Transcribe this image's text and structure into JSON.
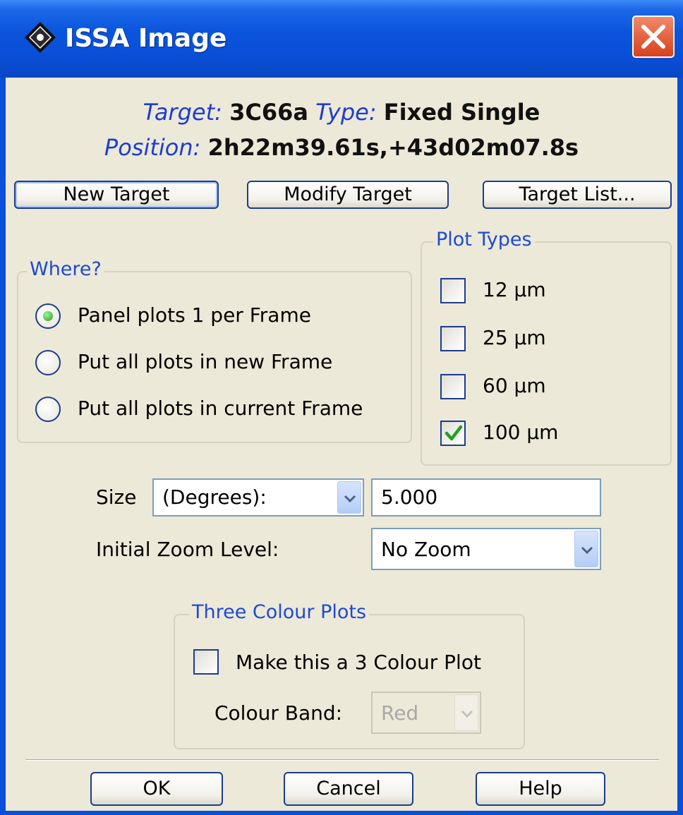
{
  "window": {
    "title": "ISSA Image",
    "icon": "app-diamond-icon",
    "close_icon": "close-x-icon"
  },
  "header": {
    "target_label": "Target:",
    "target_value": "3C66a",
    "type_label": "Type:",
    "type_value": "Fixed Single",
    "position_label": "Position:",
    "position_value": "2h22m39.61s,+43d02m07.8s"
  },
  "buttons": {
    "new_target": "New Target",
    "modify_target": "Modify Target",
    "target_list": "Target List..."
  },
  "where": {
    "title": "Where?",
    "options": [
      {
        "label": "Panel plots 1 per Frame",
        "selected": true
      },
      {
        "label": "Put all plots in new Frame",
        "selected": false
      },
      {
        "label": "Put all plots in current Frame",
        "selected": false
      }
    ]
  },
  "plot_types": {
    "title": "Plot Types",
    "items": [
      {
        "label": "12 µm",
        "checked": false
      },
      {
        "label": "25 µm",
        "checked": false
      },
      {
        "label": "60 µm",
        "checked": false
      },
      {
        "label": "100 µm",
        "checked": true
      }
    ]
  },
  "size": {
    "label": "Size",
    "unit_selected": "(Degrees):",
    "value": "5.000"
  },
  "zoom": {
    "label": "Initial Zoom Level:",
    "selected": "No Zoom"
  },
  "three_colour": {
    "title": "Three Colour Plots",
    "checkbox_label": "Make this a 3 Colour Plot",
    "checked": false,
    "band_label": "Colour Band:",
    "band_selected": "Red"
  },
  "footer": {
    "ok": "OK",
    "cancel": "Cancel",
    "help": "Help"
  },
  "colors": {
    "title_bar": "#0a4fd8",
    "dialog_bg": "#ece9d8",
    "label_blue": "#1e3cd2",
    "radio_selected": "#22a01e",
    "check_green": "#22a01e"
  }
}
